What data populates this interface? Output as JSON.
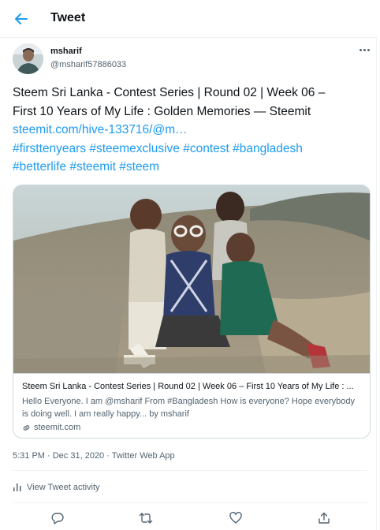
{
  "header": {
    "title": "Tweet",
    "back_icon": "arrow-left-icon"
  },
  "author": {
    "display_name": "msharif",
    "handle": "@msharif57886033"
  },
  "tweet": {
    "text_line_1": "Steem Sri Lanka - Contest Series | Round 02 | Week 06 –",
    "text_line_2": "First 10 Years of My Life : Golden Memories — Steemit",
    "link": "steemit.com/hive-133716/@m…",
    "hashtags_line_1": "#firsttenyears #steemexclusive #contest #bangladesh",
    "hashtags_line_2": "#betterlife #steemit #steem"
  },
  "card": {
    "title": "Steem Sri Lanka - Contest Series | Round 02 | Week 06 – First 10 Years of My Life : ...",
    "description": "Hello Everyone. I am @msharif From #Bangladesh How is everyone? Hope everybody is doing well. I am really happy... by msharif",
    "domain": "steemit.com"
  },
  "meta": {
    "timestamp": "5:31 PM · Dec 31, 2020 · Twitter Web App"
  },
  "activity": {
    "label": "View Tweet activity"
  },
  "actions": [
    "reply-icon",
    "retweet-icon",
    "like-icon",
    "share-icon"
  ],
  "colors": {
    "accent": "#1d9bf0",
    "text": "#0f1419",
    "muted": "#536471",
    "border": "#cfd9de"
  }
}
